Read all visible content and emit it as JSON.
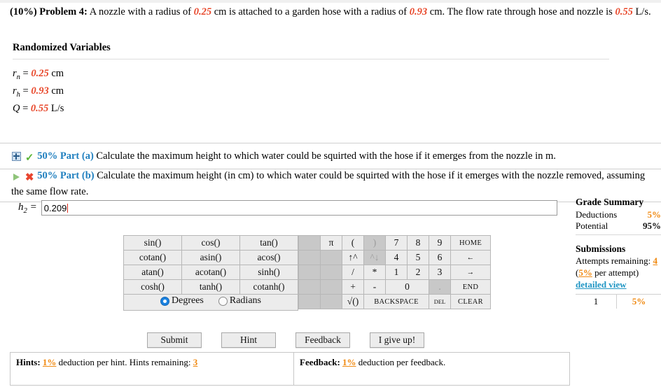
{
  "problem": {
    "weight": "(10%)",
    "label": "Problem 4:",
    "text_1": "A nozzle with a radius of ",
    "val_rn": "0.25",
    "text_2": " cm is attached to a garden hose with a radius of ",
    "val_rh": "0.93",
    "text_3": " cm. The flow rate through hose and nozzle is ",
    "val_q": "0.55",
    "text_4": " L/s."
  },
  "randomized": {
    "heading": "Randomized Variables",
    "vars": [
      {
        "name": "r",
        "sub": "n",
        "eq": " = ",
        "value": "0.25",
        "unit": " cm"
      },
      {
        "name": "r",
        "sub": "h",
        "eq": " = ",
        "value": "0.93",
        "unit": " cm"
      },
      {
        "name": "Q",
        "sub": "",
        "eq": " = ",
        "value": "0.55",
        "unit": " L/s"
      }
    ]
  },
  "parts": {
    "a": {
      "label": "50% Part (a)",
      "text": "Calculate the maximum height to which water could be squirted with the hose if it emerges from the nozzle in m.",
      "status_icon": "green-check-icon",
      "toggle_icon": "expand-plus-box-icon"
    },
    "b": {
      "label": "50% Part (b)",
      "text": "Calculate the maximum height (in cm) to which water could be squirted with the hose if it emerges with the nozzle removed, assuming the same flow rate.",
      "status_icon": "red-x-burst-icon",
      "toggle_icon": "collapse-triangle-icon"
    }
  },
  "answer": {
    "label_var": "h",
    "label_sub": "2",
    "label_eq": " = ",
    "value": "0.209",
    "placeholder": ""
  },
  "calculator": {
    "functions": [
      [
        "sin()",
        "cos()",
        "tan()"
      ],
      [
        "cotan()",
        "asin()",
        "acos()"
      ],
      [
        "atan()",
        "acotan()",
        "sinh()"
      ],
      [
        "cosh()",
        "tanh()",
        "cotanh()"
      ]
    ],
    "angle_mode": {
      "degrees_label": "Degrees",
      "radians_label": "Radians",
      "selected": "Degrees"
    },
    "keypad": {
      "row1": [
        "π",
        "(",
        ")",
        "7",
        "8",
        "9",
        "HOME"
      ],
      "row2": [
        "",
        "↑^",
        "^↓",
        "4",
        "5",
        "6",
        "←"
      ],
      "row3": [
        "",
        "/",
        "*",
        "1",
        "2",
        "3",
        "→"
      ],
      "row4": [
        "",
        "+",
        "-",
        "0",
        ".",
        "END"
      ],
      "row5": [
        "",
        "√()",
        "BACKSPACE",
        "DEL",
        "CLEAR"
      ]
    }
  },
  "buttons": {
    "submit": "Submit",
    "hint": "Hint",
    "feedback": "Feedback",
    "give_up": "I give up!"
  },
  "grade_summary": {
    "heading": "Grade Summary",
    "deductions_label": "Deductions",
    "deductions_value": "5%",
    "potential_label": "Potential",
    "potential_value": "95%"
  },
  "submissions": {
    "heading": "Submissions",
    "attempts_label": "Attempts remaining:",
    "attempts_value": "4",
    "per_attempt_open": "(",
    "per_attempt_value": "5%",
    "per_attempt_rest": " per attempt)",
    "detailed_view": "detailed view",
    "rows": [
      {
        "index": "1",
        "deduction": "5%"
      }
    ]
  },
  "hints": {
    "title": "Hints:",
    "deduction": "1%",
    "text_mid": " deduction per hint. Hints remaining: ",
    "remaining": "3"
  },
  "feedback_box": {
    "title": "Feedback:",
    "deduction": "1%",
    "text": " deduction per feedback."
  },
  "colors": {
    "variable_red": "#e8472a",
    "part_blue": "#1f7fbf",
    "orange": "#f08a12",
    "link_cyan": "#2196c4",
    "radio_blue": "#1b82e0"
  }
}
